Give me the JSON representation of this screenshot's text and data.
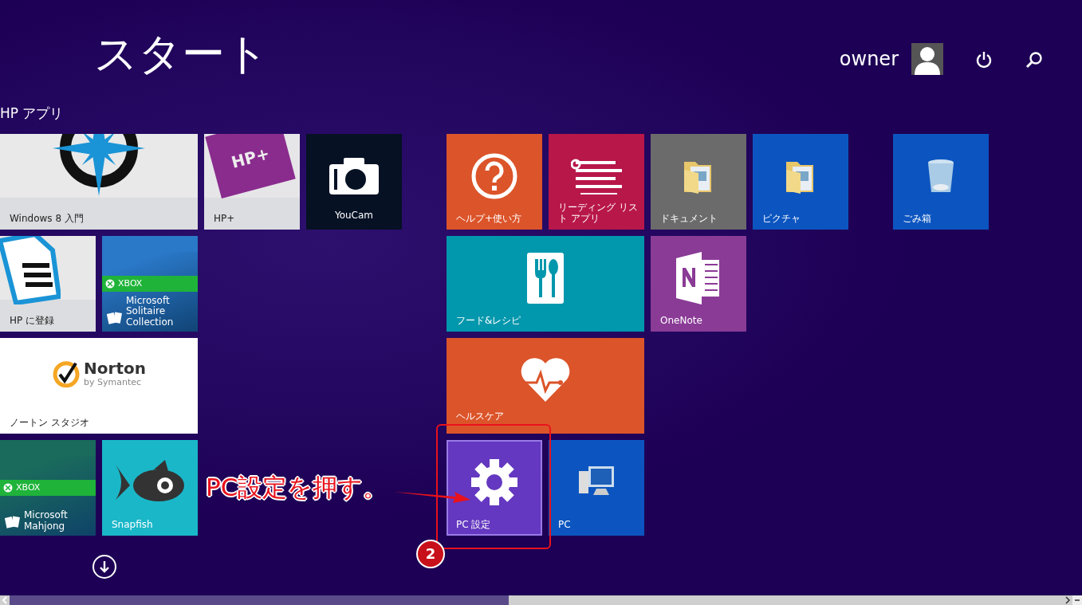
{
  "title": "スタート",
  "user": {
    "name": "owner"
  },
  "section_heading": "HP アプリ",
  "groups": [
    {
      "rows": [
        {
          "tiles": [
            {
              "label": "Windows 8 入門",
              "color": "#e9e9ea",
              "kind": "compass",
              "selected": false
            },
            {
              "label": "HP+",
              "color": "#e6e6e8",
              "kind": "bag",
              "logo_text": "HP+",
              "selected": false
            },
            {
              "label": "YouCam",
              "color": "#061124",
              "kind": "camera",
              "selected": false
            }
          ]
        },
        {
          "tiles": [
            {
              "label": "HP に登録",
              "color": "#e8e8e8",
              "kind": "document",
              "selected": false
            },
            {
              "label": "Microsoft Solitaire Collection",
              "color": "#2a78c8",
              "kind": "xbox",
              "banner": "XBOX",
              "selected": false
            }
          ]
        },
        {
          "tiles": [
            {
              "label": "ノートン スタジオ",
              "color": "#ffffff",
              "kind": "norton",
              "logo": {
                "name": "Norton",
                "byline": "by Symantec"
              },
              "selected": false
            }
          ]
        },
        {
          "tiles": [
            {
              "label": "Microsoft Mahjong",
              "color": "#1a6b5c",
              "kind": "xbox",
              "banner": "XBOX",
              "selected": false
            },
            {
              "label": "Snapfish",
              "color": "#1ab7c9",
              "kind": "fish",
              "selected": false
            }
          ]
        }
      ]
    },
    {
      "rows": [
        {
          "tiles": [
            {
              "label": "ヘルプ+使い方",
              "color": "#dc542a",
              "kind": "help",
              "selected": false
            },
            {
              "label": "リーディング リスト アプリ",
              "color": "#b8174a",
              "kind": "lines",
              "selected": false
            },
            {
              "label": "ドキュメント",
              "color": "#6b6b6b",
              "kind": "folder",
              "selected": false
            },
            {
              "label": "ピクチャ",
              "color": "#0c55c0",
              "kind": "folder",
              "selected": false
            }
          ]
        },
        {
          "tiles": [
            {
              "label": "フード&レシピ",
              "color": "#0197ac",
              "kind": "cutlery",
              "selected": false
            },
            {
              "label": "OneNote",
              "color": "#8a3b96",
              "kind": "notebook",
              "selected": false
            }
          ]
        },
        {
          "tiles": [
            {
              "label": "ヘルスケア",
              "color": "#dc542a",
              "kind": "heart",
              "selected": false
            }
          ]
        },
        {
          "tiles": [
            {
              "label": "PC 設定",
              "color": "#6438c0",
              "kind": "gear",
              "selected": true
            },
            {
              "label": "PC",
              "color": "#0c55c0",
              "kind": "monitor",
              "selected": false
            }
          ]
        }
      ]
    },
    {
      "rows": [
        {
          "tiles": [
            {
              "label": "ごみ箱",
              "color": "#0c55c0",
              "kind": "bin",
              "selected": false
            }
          ]
        }
      ]
    }
  ],
  "annotation": {
    "text": "PC設定を押す。",
    "step": "2"
  }
}
